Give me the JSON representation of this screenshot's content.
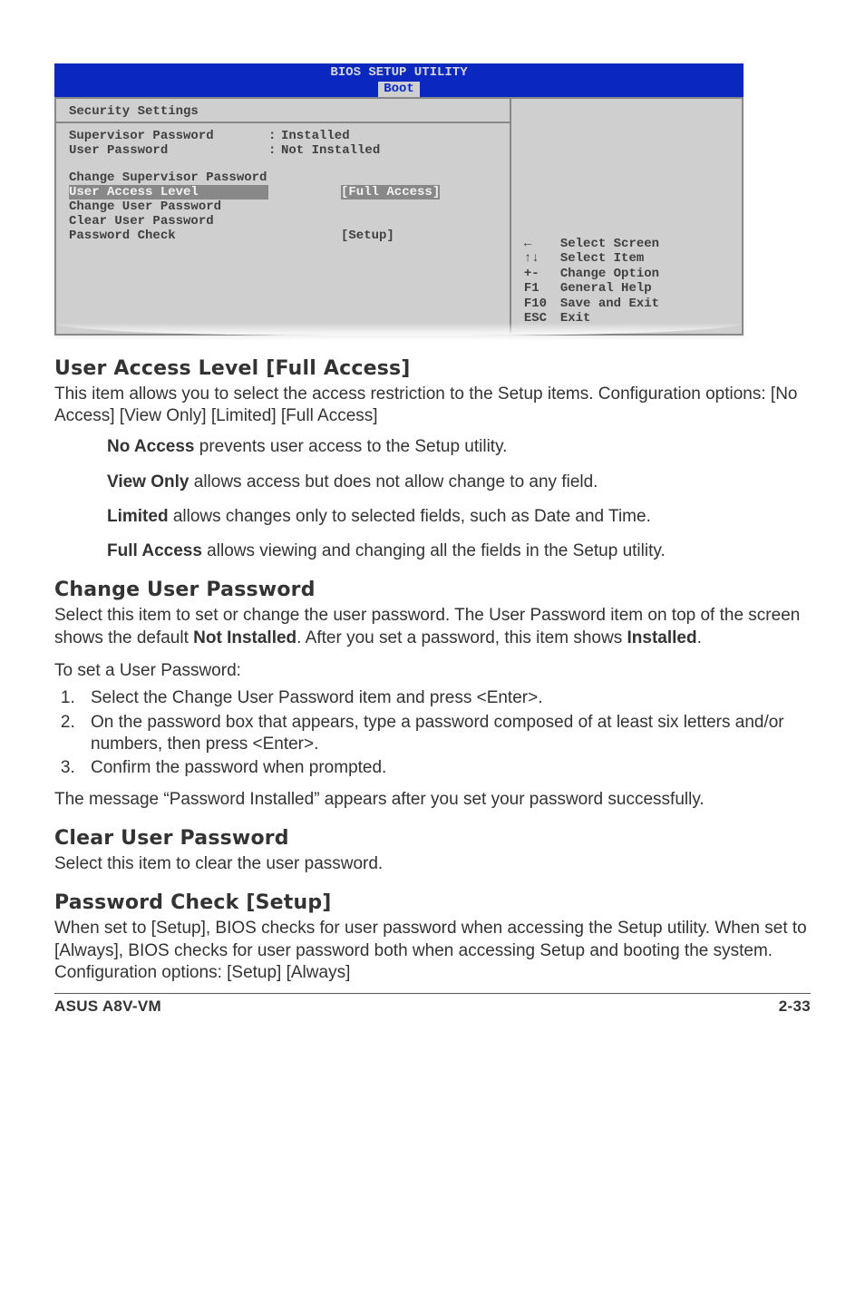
{
  "bios": {
    "title": "BIOS SETUP UTILITY",
    "tab": "Boot",
    "section": "Security Settings",
    "rows": {
      "sup_pw_label": "Supervisor Password",
      "sup_pw_val": "Installed",
      "user_pw_label": "User Password",
      "user_pw_val": "Not Installed",
      "chg_sup": "Change Supervisor Password",
      "ual_label": "User Access Level",
      "ual_val": "[Full Access]",
      "chg_user": "Change User Password",
      "clr_user": "Clear User Password",
      "pw_chk_label": "Password Check",
      "pw_chk_val": "[Setup]"
    },
    "legend": {
      "l1": "Select Screen",
      "l2": "Select Item",
      "k3": "+-",
      "l3": "Change Option",
      "k4": "F1",
      "l4": "General Help",
      "k5": "F10",
      "l5": "Save and Exit",
      "k6": "ESC",
      "l6": "Exit"
    }
  },
  "sec1": {
    "h": "User Access Level [Full Access]",
    "p": "This item allows you to select the access restriction to the Setup items. Configuration options: [No Access] [View Only] [Limited] [Full Access]",
    "na_b": "No Access",
    "na_t": " prevents user access to the Setup utility.",
    "vo_b": "View Only",
    "vo_t": " allows access but does not allow change to any field.",
    "li_b": "Limited",
    "li_t": " allows changes only to selected fields, such as Date and Time.",
    "fa_b": "Full Access",
    "fa_t": " allows viewing and changing all the fields in the Setup utility."
  },
  "sec2": {
    "h": "Change User Password",
    "p1a": "Select this item to set or change the user password. The User Password item on top of the screen shows the default ",
    "p1b": "Not Installed",
    "p1c": ". After you set a password, this item shows ",
    "p1d": "Installed",
    "p1e": ".",
    "p2": "To set a User Password:",
    "steps": [
      "Select the Change User Password item and press <Enter>.",
      "On the password box that appears, type a password composed of at least six letters and/or numbers, then press <Enter>.",
      "Confirm the password when prompted."
    ],
    "p3": "The message “Password Installed” appears after you set your password successfully."
  },
  "sec3": {
    "h": "Clear User Password",
    "p": "Select this item to clear the user password."
  },
  "sec4": {
    "h": "Password Check [Setup]",
    "p": "When set to [Setup], BIOS checks for user password when accessing the Setup utility. When set to [Always], BIOS checks for user password both when accessing Setup and booting the system.\nConfiguration options: [Setup] [Always]"
  },
  "footer": {
    "left": "ASUS A8V-VM",
    "right": "2-33"
  }
}
